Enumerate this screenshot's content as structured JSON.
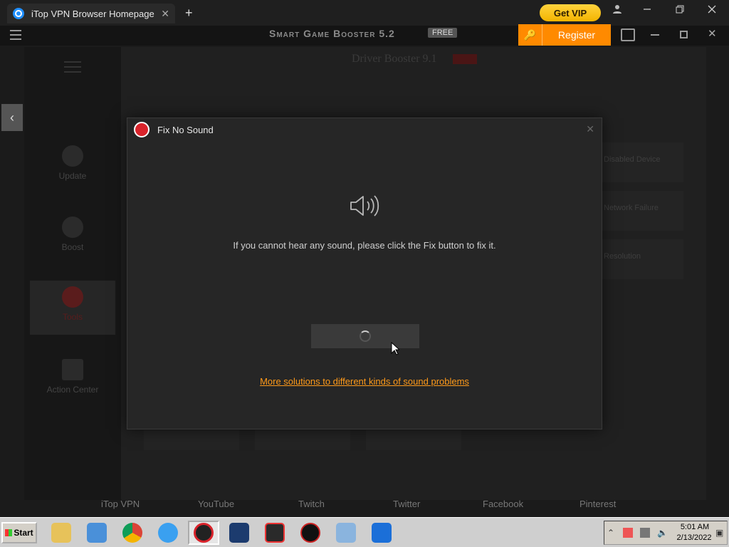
{
  "browser": {
    "tab_title": "iTop VPN Browser Homepage",
    "tab_close": "✕",
    "new_tab": "+",
    "get_vip": "Get VIP",
    "window_controls": [
      "user-icon",
      "minimize-icon",
      "restore-icon",
      "close-icon"
    ]
  },
  "app": {
    "title": "Smart Game Booster 5.2",
    "badge": "FREE",
    "register_label": "Register"
  },
  "background_app": {
    "title": "Driver Booster 9.1",
    "sidebar": [
      {
        "label": "Update"
      },
      {
        "label": "Boost"
      },
      {
        "label": "Tools"
      },
      {
        "label": "Action Center"
      }
    ],
    "cards": [
      "Disabled Device",
      "Network Failure",
      "Resolution"
    ]
  },
  "bookmarks": [
    "iTop VPN",
    "YouTube",
    "Twitch",
    "Twitter",
    "Facebook",
    "Pinterest"
  ],
  "dialog": {
    "title": "Fix No Sound",
    "close": "✕",
    "message": "If you cannot hear any sound, please click the Fix button to fix it.",
    "more_link": "More solutions to different kinds of sound problems"
  },
  "taskbar": {
    "start_label": "Start",
    "time": "5:01 AM",
    "date": "2/13/2022"
  },
  "colors": {
    "accent_orange": "#ff8a00",
    "vip_yellow": "#f3b400",
    "brand_red": "#d9232b",
    "link_orange": "#ff9a1a"
  }
}
